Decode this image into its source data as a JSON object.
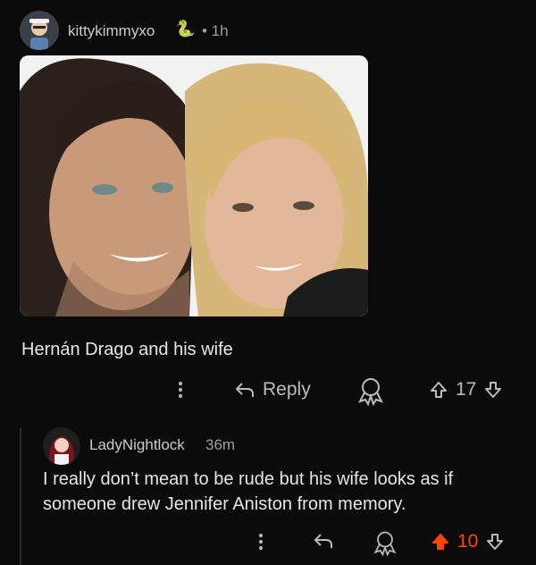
{
  "comment1": {
    "username": "kittykimmyxo",
    "flair_icon": "snake-emoji",
    "time": "• 1h",
    "text": "Hernán Drago and his wife",
    "reply_label": "Reply",
    "votes": "17"
  },
  "comment2": {
    "username": "LadyNightlock",
    "time": "36m",
    "text": "I really don’t mean to be rude but his wife looks as if someone drew Jennifer Aniston from memory.",
    "votes": "10"
  },
  "colors": {
    "background": "#0b0b0b",
    "upvote_active": "#ff4500",
    "text": "#e4e6e8"
  },
  "icons": [
    "more-vertical-icon",
    "reply-arrow-icon",
    "award-icon",
    "upvote-icon",
    "downvote-icon"
  ]
}
